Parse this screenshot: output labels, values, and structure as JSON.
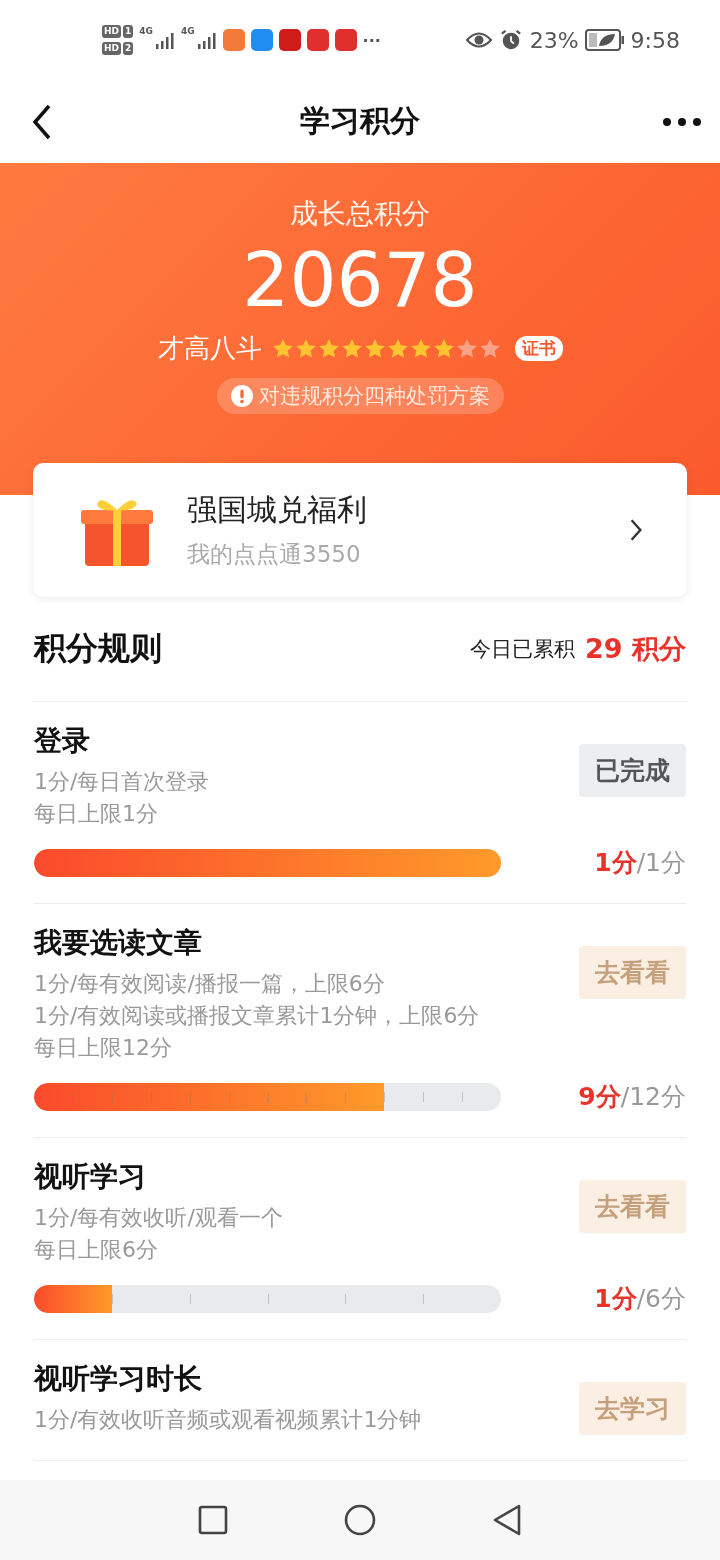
{
  "status_bar": {
    "sims": [
      {
        "badge": "HD",
        "slot": "1"
      },
      {
        "badge": "HD",
        "slot": "2"
      }
    ],
    "networks": [
      "4G",
      "4G"
    ],
    "apps": [
      {
        "color": "#f47a3a"
      },
      {
        "color": "#1f8ef0"
      },
      {
        "color": "#d01b1b"
      },
      {
        "color": "#e0302e"
      },
      {
        "color": "#e0302e"
      }
    ],
    "more": "···",
    "battery_text": "23%",
    "time": "9:58"
  },
  "header": {
    "title": "学习积分"
  },
  "summary": {
    "label": "成长总积分",
    "total": "20678",
    "rank": "才高八斗",
    "stars": 8,
    "certificate": "证书",
    "notice": "对违规积分四种处罚方案"
  },
  "welfare": {
    "title": "强国城兑福利",
    "subtitle": "我的点点通3550"
  },
  "rules": {
    "title": "积分规则",
    "today_label": "今日已累积",
    "today_value": "29 积分"
  },
  "tasks": [
    {
      "title": "登录",
      "lines": [
        "1分/每日首次登录",
        "每日上限1分"
      ],
      "button": "已完成",
      "done": true,
      "kind": "plain",
      "level": 1,
      "earned": "1分",
      "cap": "/1分"
    },
    {
      "title": "我要选读文章",
      "lines": [
        "1分/每有效阅读/播报一篇，上限6分",
        "1分/有效阅读或播报文章累计1分钟，上限6分",
        "每日上限12分"
      ],
      "button": "去看看",
      "done": false,
      "kind": "segmented",
      "level": 0.75,
      "earned": "9分",
      "cap": "/12分"
    },
    {
      "title": "视听学习",
      "lines": [
        "1分/每有效收听/观看一个",
        "每日上限6分"
      ],
      "button": "去看看",
      "done": false,
      "kind": "segmented",
      "level": 0.1667,
      "earned": "1分",
      "cap": "/6分"
    },
    {
      "title": "视听学习时长",
      "lines": [
        "1分/有效收听音频或观看视频累计1分钟"
      ],
      "button": "去学习",
      "done": false,
      "kind": "none"
    }
  ]
}
